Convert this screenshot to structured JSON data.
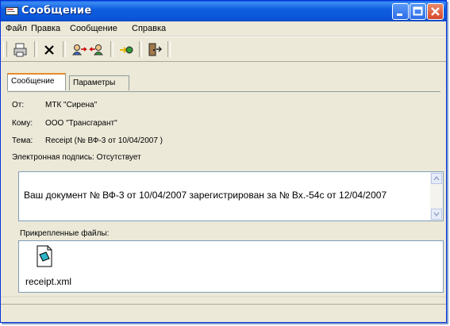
{
  "window": {
    "title": "Сообщение"
  },
  "menu": {
    "items": [
      "Файл",
      "Правка",
      "Сообщение",
      "Справка"
    ]
  },
  "toolbar": {
    "buttons": [
      "print-icon",
      "delete-icon",
      "reply-icon",
      "reply-all-icon",
      "forward-icon",
      "exit-icon"
    ]
  },
  "tabs": [
    "Сообщение",
    "Параметры"
  ],
  "message": {
    "from_label": "От:",
    "from": "МТК \"Сирена\"",
    "to_label": "Кому:",
    "to": "ООО \"Трансгарант\"",
    "subject_label": "Тема:",
    "subject": "Receipt (№ ВФ-3 от 10/04/2007  )",
    "signature": "Электронная подпись: Отсутствует",
    "body": "Ваш документ № ВФ-3 от 10/04/2007 зарегистрирован за № Вх.-54с от 12/04/2007"
  },
  "attachments": {
    "label": "Прикрепленные файлы:",
    "files": [
      {
        "name": "receipt.xml"
      }
    ]
  },
  "colors": {
    "title_bar": "#0b55d9",
    "close_button": "#d7472a",
    "window_bg": "#ece9d8"
  }
}
